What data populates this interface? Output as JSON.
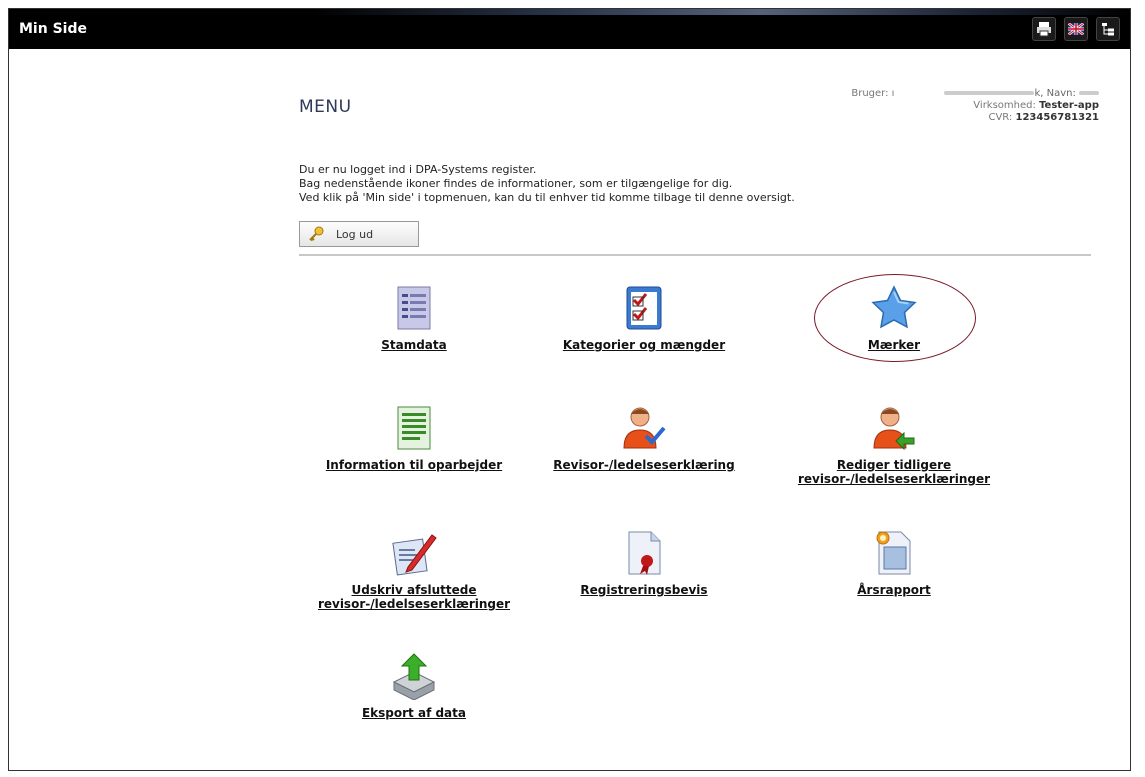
{
  "topbar": {
    "title": "Min Side",
    "tools": [
      {
        "icon": "print-icon"
      },
      {
        "icon": "uk-flag-icon"
      },
      {
        "icon": "sitemap-icon"
      }
    ]
  },
  "header": {
    "menu_title": "MENU",
    "user_label": "Bruger: ı",
    "user_name": "k, Navn: ",
    "company_label": "Virksomhed:",
    "company_value": "Tester-app",
    "cvr_label": "CVR:",
    "cvr_value": "123456781321"
  },
  "intro": {
    "line1": "Du er nu logget ind i DPA-Systems register.",
    "line2": "Bag nedenstående ikoner findes de informationer, som er tilgængelige for dig.",
    "line3": "Ved klik på 'Min side' i topmenuen, kan du til enhver tid komme tilbage til denne oversigt."
  },
  "logout_label": "Log ud",
  "menu_items": [
    {
      "label": "Stamdata",
      "icon": "document-list-icon"
    },
    {
      "label": "Kategorier og mængder",
      "icon": "checklist-icon"
    },
    {
      "label": "Mærker",
      "icon": "star-icon"
    },
    {
      "label": "Information til oparbejder",
      "icon": "green-document-icon"
    },
    {
      "label": "Revisor-/ledelseserklæring",
      "icon": "person-check-icon"
    },
    {
      "label1": "Rediger tidligere",
      "label2": "revisor-/ledelseserklæringer",
      "icon": "person-arrow-icon"
    },
    {
      "label1": "Udskriv afsluttede",
      "label2": "revisor-/ledelseserklæringer",
      "icon": "sign-document-icon"
    },
    {
      "label": "Registreringsbevis",
      "icon": "certificate-icon"
    },
    {
      "label": "Årsrapport",
      "icon": "annual-report-icon"
    },
    {
      "label": "Eksport af data",
      "icon": "export-icon"
    }
  ],
  "colors": {
    "topbar": "#000000",
    "highlight_circle": "#7a1a2a",
    "menu_title": "#2f3a5a"
  }
}
